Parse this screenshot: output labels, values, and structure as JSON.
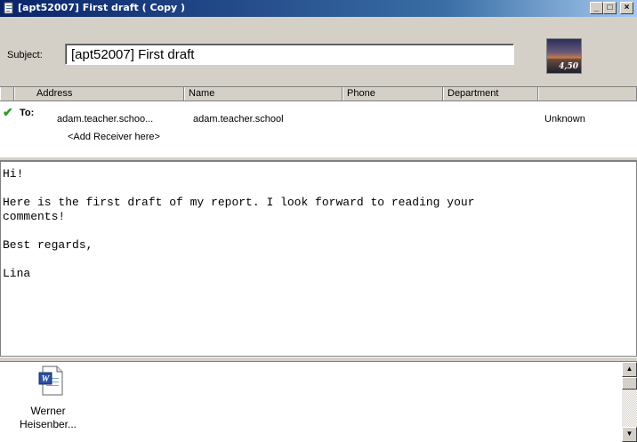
{
  "window": {
    "title": "[apt52007] First draft ( Copy )",
    "minimize": "_",
    "maximize": "□",
    "close": "×"
  },
  "subject": {
    "label": "Subject:",
    "value": "[apt52007] First draft"
  },
  "thumbnail": {
    "label": "4,50"
  },
  "recipients": {
    "columns": [
      "Address",
      "Name",
      "Phone",
      "Department",
      ""
    ],
    "rows": [
      {
        "type": "To:",
        "address": "adam.teacher.schoo...",
        "name": "adam.teacher.school",
        "phone": "",
        "department": "",
        "status": "Unknown"
      }
    ],
    "add_placeholder": "<Add Receiver here>"
  },
  "message": {
    "lines": [
      "Hi!",
      "Here is the first draft of my report. I look forward to reading your\ncomments!",
      "Best regards,",
      "Lina"
    ]
  },
  "attachments": [
    {
      "icon": "word-document-icon",
      "name": "Werner\nHeisenber..."
    }
  ]
}
